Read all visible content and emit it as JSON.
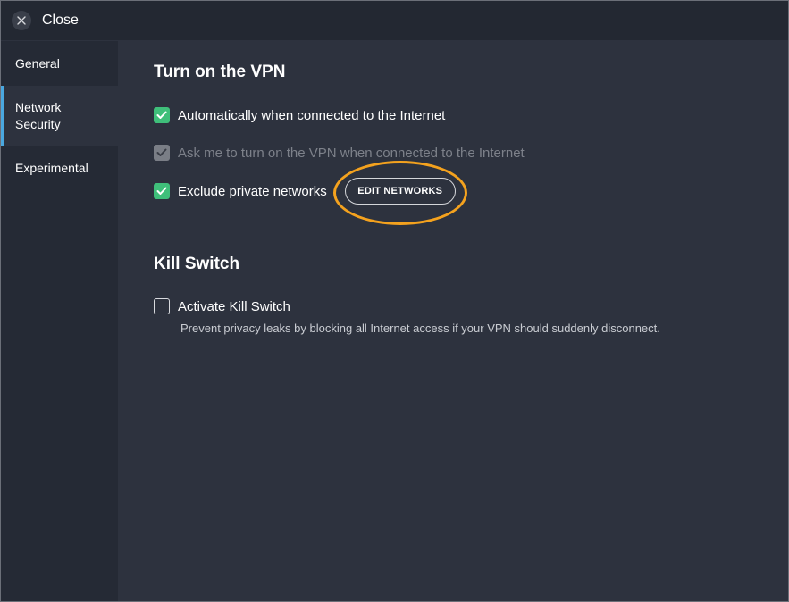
{
  "titlebar": {
    "close_label": "Close"
  },
  "sidebar": {
    "items": [
      {
        "label": "General"
      },
      {
        "label": "Network\nSecurity"
      },
      {
        "label": "Experimental"
      }
    ]
  },
  "vpn": {
    "title": "Turn on the VPN",
    "auto_label": "Automatically when connected to the Internet",
    "ask_label": "Ask me to turn on the VPN when connected to the Internet",
    "exclude_label": "Exclude private networks",
    "edit_networks_label": "EDIT NETWORKS"
  },
  "kill_switch": {
    "title": "Kill Switch",
    "activate_label": "Activate Kill Switch",
    "description": "Prevent privacy leaks by blocking all Internet access if your VPN should suddenly disconnect."
  },
  "colors": {
    "checkbox_checked": "#3fbf7a",
    "highlight": "#f4a21e",
    "active_tab_accent": "#4aa8e0"
  }
}
